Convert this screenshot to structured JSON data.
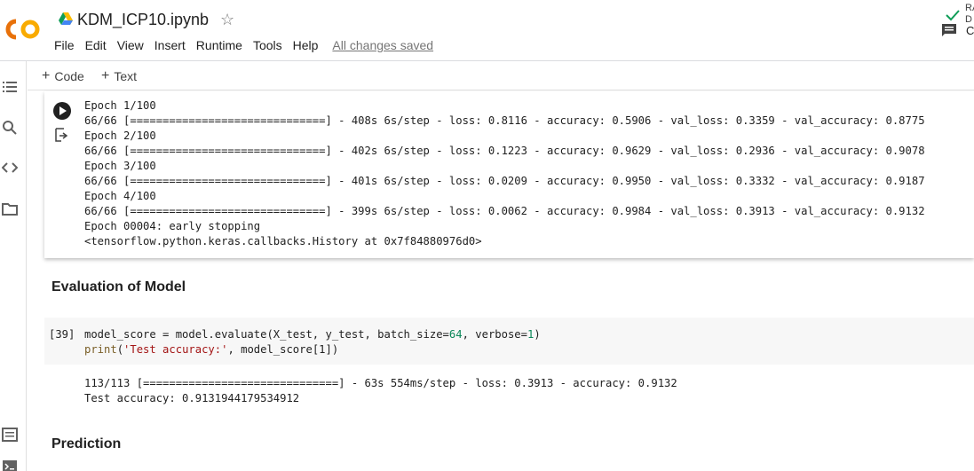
{
  "header": {
    "logo_text": "CO",
    "title": "KDM_ICP10.ipynb",
    "menu": [
      "File",
      "Edit",
      "View",
      "Insert",
      "Runtime",
      "Tools",
      "Help"
    ],
    "save_status": "All changes saved",
    "comment_label": "C"
  },
  "toolbar": {
    "code_label": "Code",
    "text_label": "Text",
    "connect_status": "RA D"
  },
  "output_cell": {
    "lines": [
      "Epoch 1/100",
      "66/66 [==============================] - 408s 6s/step - loss: 0.8116 - accuracy: 0.5906 - val_loss: 0.3359 - val_accuracy: 0.8775",
      "Epoch 2/100",
      "66/66 [==============================] - 402s 6s/step - loss: 0.1223 - accuracy: 0.9629 - val_loss: 0.2936 - val_accuracy: 0.9078",
      "Epoch 3/100",
      "66/66 [==============================] - 401s 6s/step - loss: 0.0209 - accuracy: 0.9950 - val_loss: 0.3332 - val_accuracy: 0.9187",
      "Epoch 4/100",
      "66/66 [==============================] - 399s 6s/step - loss: 0.0062 - accuracy: 0.9984 - val_loss: 0.3913 - val_accuracy: 0.9132",
      "Epoch 00004: early stopping",
      "<tensorflow.python.keras.callbacks.History at 0x7f84880976d0>"
    ]
  },
  "sections": {
    "evaluation": "Evaluation of Model",
    "prediction": "Prediction"
  },
  "code_cell": {
    "exec_count": "[39]",
    "line1": {
      "a": "model_score = model.evaluate(X_test, y_test, batch_size=",
      "num1": "64",
      "b": ", verbose=",
      "num2": "1",
      "c": ")"
    },
    "line2": {
      "fn": "print",
      "a": "(",
      "str": "'Test accuracy:'",
      "b": ", model_score[1])"
    },
    "output": [
      "113/113 [==============================] - 63s 554ms/step - loss: 0.3913 - accuracy: 0.9132",
      "Test accuracy: 0.9131944179534912"
    ]
  },
  "colors": {
    "logo_orange": "#f9ab00",
    "logo_dark_orange": "#e8710a",
    "check_green": "#0f9d58"
  }
}
